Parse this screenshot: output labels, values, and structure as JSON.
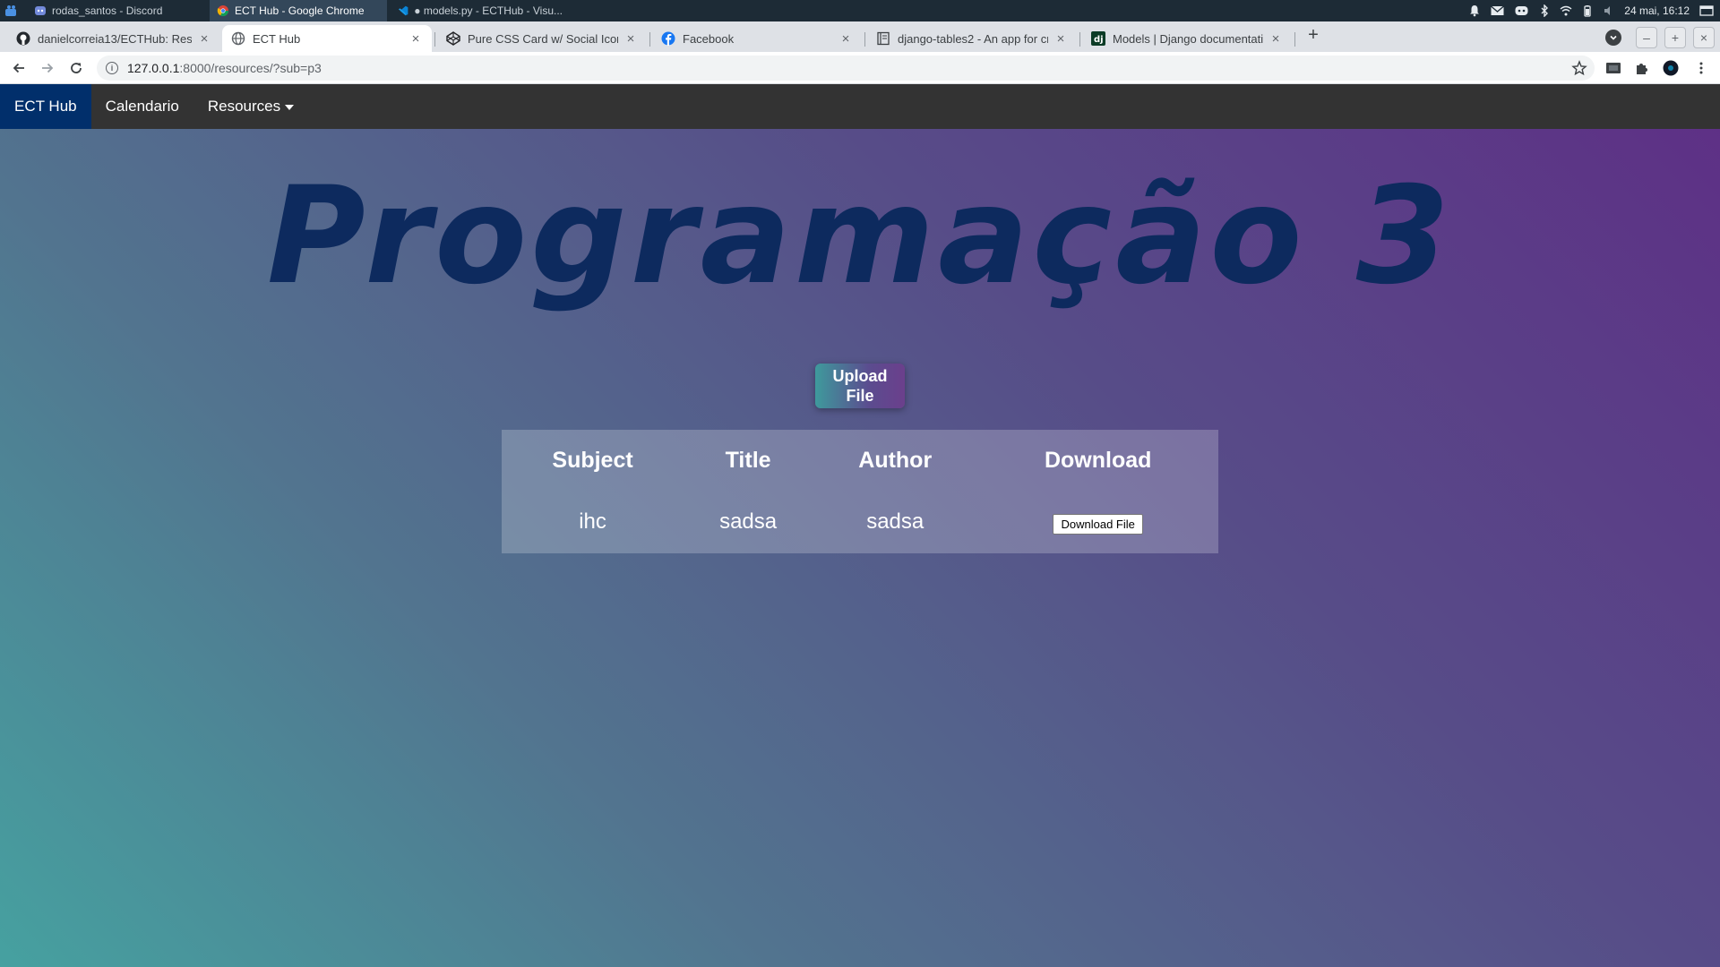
{
  "taskbar": {
    "windows": [
      {
        "label": "rodas_santos - Discord",
        "icon": "discord-icon",
        "active": false
      },
      {
        "label": "ECT Hub - Google Chrome",
        "icon": "chrome-icon",
        "active": true
      },
      {
        "label": "● models.py - ECTHub - Visu...",
        "icon": "vscode-icon",
        "active": false
      }
    ],
    "clock": "24 mai, 16:12"
  },
  "browser": {
    "tabs": [
      {
        "title": "danielcorreia13/ECTHub: Reso",
        "icon": "github-icon",
        "active": false
      },
      {
        "title": "ECT Hub",
        "icon": "globe-icon",
        "active": true
      },
      {
        "title": "Pure CSS Card w/ Social Icons",
        "icon": "codepen-icon",
        "active": false
      },
      {
        "title": "Facebook",
        "icon": "facebook-icon",
        "active": false
      },
      {
        "title": "django-tables2 - An app for cre",
        "icon": "docs-icon",
        "active": false
      },
      {
        "title": "Models | Django documentatio",
        "icon": "django-icon",
        "active": false
      }
    ],
    "url_host": "127.0.0.1",
    "url_path": ":8000/resources/?sub=p3"
  },
  "navbar": {
    "brand": "ECT Hub",
    "items": [
      "Calendario",
      "Resources"
    ]
  },
  "page": {
    "heading": "Programação 3",
    "upload_label": "Upload\nFile",
    "table": {
      "headers": [
        "Subject",
        "Title",
        "Author",
        "Download"
      ],
      "rows": [
        {
          "subject": "ihc",
          "title": "sadsa",
          "author": "sadsa",
          "download_label": "Download File"
        }
      ]
    }
  },
  "colors": {
    "navbar_bg": "#333333",
    "brand_bg": "#012f6b",
    "heading": "#0d2a5e",
    "gradient_start": "#46a1a0",
    "gradient_end": "#5e2f86"
  }
}
